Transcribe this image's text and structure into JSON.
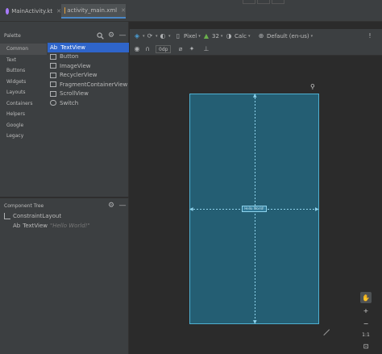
{
  "tabs": [
    {
      "label": "MainActivity.kt",
      "icon": "kotlin-file-icon",
      "active": false
    },
    {
      "label": "activity_main.xml",
      "icon": "xml-layout-icon",
      "active": true
    }
  ],
  "palette": {
    "title": "Palette",
    "categories": [
      "Common",
      "Text",
      "Buttons",
      "Widgets",
      "Layouts",
      "Containers",
      "Helpers",
      "Google",
      "Legacy"
    ],
    "selected_category": "Common",
    "widgets": [
      {
        "label": "TextView",
        "icon": "Ab"
      },
      {
        "label": "Button",
        "icon": "button-icon"
      },
      {
        "label": "ImageView",
        "icon": "image-icon"
      },
      {
        "label": "RecyclerView",
        "icon": "list-icon"
      },
      {
        "label": "FragmentContainerView",
        "icon": "fragment-icon"
      },
      {
        "label": "ScrollView",
        "icon": "scroll-icon"
      },
      {
        "label": "Switch",
        "icon": "toggle-icon"
      }
    ],
    "selected_widget": "TextView"
  },
  "component_tree": {
    "title": "Component Tree",
    "root": "ConstraintLayout",
    "child": {
      "icon": "Ab",
      "label": "TextView",
      "detail": "\"Hello World!\""
    }
  },
  "toolbar": {
    "device": "Pixel",
    "api": "32",
    "theme": "Calc",
    "locale": "Default (en-us)",
    "margin": "0dp"
  },
  "canvas": {
    "textview_text": "Hello World!"
  },
  "zoom": {
    "ratio_label": "1:1"
  },
  "colors": {
    "accent": "#2f65ca",
    "device_fill": "#245e73",
    "constraint_line": "#8fd3ec",
    "background": "#2b2b2b"
  }
}
